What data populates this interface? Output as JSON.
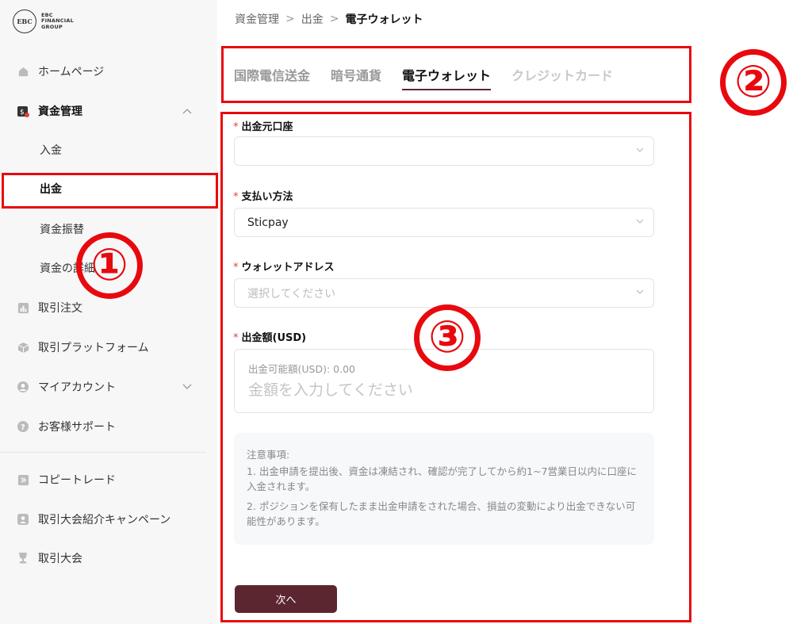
{
  "logo": {
    "mark": "EBC",
    "text_lines": [
      "EBC",
      "FINANCIAL",
      "GROUP"
    ]
  },
  "sidebar": {
    "items": [
      {
        "label": "ホームページ",
        "icon": "home-icon"
      },
      {
        "label": "資金管理",
        "icon": "funds-icon",
        "expanded": true
      },
      {
        "label": "入金",
        "sub": true
      },
      {
        "label": "出金",
        "sub": true,
        "active": true
      },
      {
        "label": "資金振替",
        "sub": true
      },
      {
        "label": "資金の詳細",
        "sub": true
      },
      {
        "label": "取引注文",
        "icon": "chart-icon"
      },
      {
        "label": "取引プラットフォーム",
        "icon": "cube-icon"
      },
      {
        "label": "マイアカウント",
        "icon": "user-icon",
        "expandable": true
      },
      {
        "label": "お客様サポート",
        "icon": "help-icon"
      },
      {
        "label": "コピートレード",
        "icon": "copy-icon"
      },
      {
        "label": "取引大会紹介キャンペーン",
        "icon": "referral-icon"
      },
      {
        "label": "取引大会",
        "icon": "trophy-icon"
      }
    ]
  },
  "breadcrumb": {
    "items": [
      "資金管理",
      "出金",
      "電子ウォレット"
    ],
    "separator": ">"
  },
  "tabs": [
    {
      "label": "国際電信送金",
      "active": false
    },
    {
      "label": "暗号通貨",
      "active": false
    },
    {
      "label": "電子ウォレット",
      "active": true
    },
    {
      "label": "クレジットカード",
      "active": false
    }
  ],
  "form": {
    "source_account": {
      "label": "出金元口座",
      "value": ""
    },
    "payment_method": {
      "label": "支払い方法",
      "value": "Sticpay"
    },
    "wallet_address": {
      "label": "ウォレットアドレス",
      "placeholder": "選択してください"
    },
    "amount": {
      "label": "出金額(USD)",
      "available": "出金可能額(USD): 0.00",
      "placeholder": "金額を入力してください"
    }
  },
  "notice": {
    "title": "注意事項:",
    "items": [
      "1. 出金申請を提出後、資金は凍結され、確認が完了してから約1~7営業日以内に口座に入金されます。",
      "2. ポジションを保有したまま出金申請をされた場合、損益の変動により出金できない可能性があります。"
    ]
  },
  "next_button": {
    "label": "次へ"
  },
  "annotations": [
    "①",
    "②",
    "③"
  ],
  "colors": {
    "accent": "#5c2630",
    "annotation": "#e8090e",
    "required": "#e04040",
    "sidebar_bg": "#f7f7f8"
  }
}
